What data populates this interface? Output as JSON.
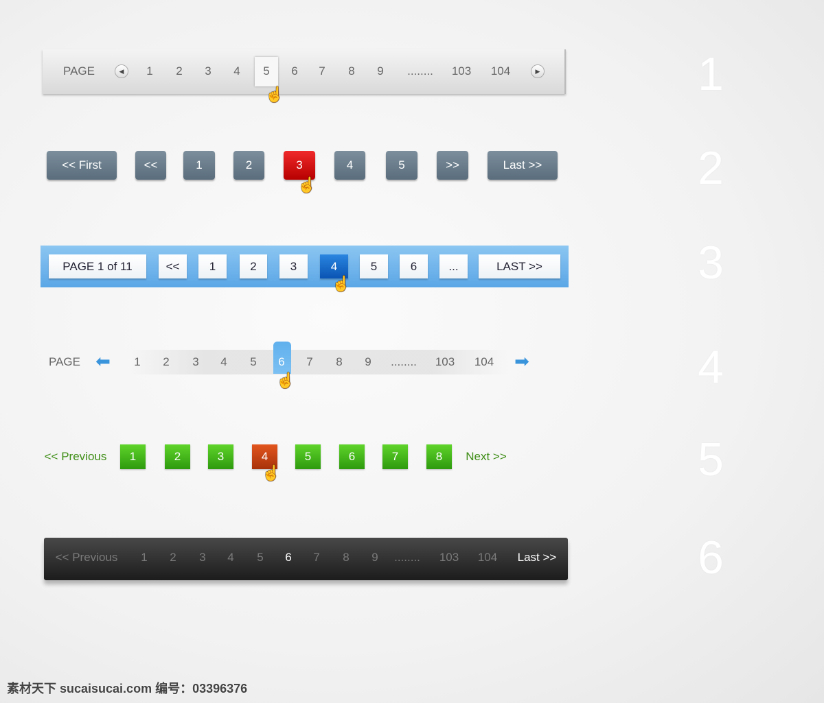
{
  "pager1": {
    "label": "PAGE",
    "prev_icon": "circle-arrow-left",
    "next_icon": "circle-arrow-right",
    "pages": [
      "1",
      "2",
      "3",
      "4",
      "5",
      "6",
      "7",
      "8",
      "9",
      "........",
      "103",
      "104"
    ],
    "active": "5"
  },
  "pager2": {
    "first": "<< First",
    "prev": "<<",
    "pages": [
      "1",
      "2",
      "3",
      "4",
      "5"
    ],
    "next": ">>",
    "last": "Last >>",
    "active": "3",
    "colors": {
      "button": "#687b8a",
      "active": "#d81010"
    }
  },
  "pager3": {
    "info": "PAGE 1 of 11",
    "prev": "<<",
    "pages": [
      "1",
      "2",
      "3",
      "4",
      "5",
      "6",
      "..."
    ],
    "last": "LAST >>",
    "active": "4",
    "colors": {
      "bar": "#6fb4ec",
      "active": "#1466c8"
    }
  },
  "pager4": {
    "label": "PAGE",
    "prev_icon": "arrow-left",
    "next_icon": "arrow-right",
    "pages": [
      "1",
      "2",
      "3",
      "4",
      "5",
      "6",
      "7",
      "8",
      "9",
      "........",
      "103",
      "104"
    ],
    "active": "6"
  },
  "pager5": {
    "prev": "<< Previous",
    "pages": [
      "1",
      "2",
      "3",
      "4",
      "5",
      "6",
      "7",
      "8"
    ],
    "next": "Next >>",
    "active": "4",
    "colors": {
      "button": "#44b61c",
      "active": "#c8441a",
      "link": "#3f8e17"
    }
  },
  "pager6": {
    "prev": "<< Previous",
    "pages": [
      "1",
      "2",
      "3",
      "4",
      "5",
      "6",
      "7",
      "8",
      "9",
      "........",
      "103",
      "104"
    ],
    "last": "Last >>",
    "active": "6"
  },
  "labels": [
    "1",
    "2",
    "3",
    "4",
    "5",
    "6"
  ],
  "watermark": "素材天下 sucaisucai.com  编号：03396376"
}
